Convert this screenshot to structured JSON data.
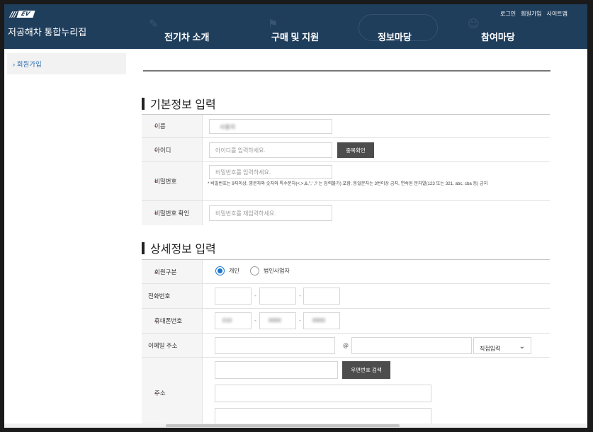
{
  "header": {
    "logo": "EV",
    "site_title": "저공해차 통합누리집",
    "util_links": [
      "로그인",
      "회원가입",
      "사이트맵"
    ],
    "nav": [
      "전기차 소개",
      "구매 및 지원",
      "정보마당",
      "참여마당"
    ]
  },
  "sidebar": {
    "items": [
      {
        "label": "› 회원가입"
      }
    ]
  },
  "basic": {
    "title": "기본정보 입력",
    "name": {
      "label": "이름",
      "value": "사용자"
    },
    "id": {
      "label": "아이디",
      "placeholder": "아이디를 입력하세요.",
      "button": "중복확인"
    },
    "password": {
      "label": "비밀번호",
      "placeholder": "비밀번호를 입력하세요.",
      "hint": "* 비밀번호는 9자이상, 영문자와 숫자와 특수문자(<,>,&,\",' ,? 는 입력불가) 포함, 동일문자는 3번이상 금지, 연속된 문자열(123 또는 321, abc, cba 등) 금지"
    },
    "password_confirm": {
      "label": "비밀번호 확인",
      "placeholder": "비밀번호를 재입력하세요."
    }
  },
  "detail": {
    "title": "상세정보 입력",
    "member_type": {
      "label": "회원구분",
      "options": [
        "개인",
        "법인사업자"
      ],
      "selected": "개인"
    },
    "phone": {
      "label": "전화번호",
      "separator": "-"
    },
    "mobile": {
      "label": "휴대폰번호",
      "values": [
        "010",
        "0000",
        "0000"
      ],
      "separator": "-"
    },
    "email": {
      "label": "이메일 주소",
      "at": "@",
      "domain_select": "직접입력"
    },
    "address": {
      "label": "주소",
      "button": "우편번호 검색"
    }
  }
}
